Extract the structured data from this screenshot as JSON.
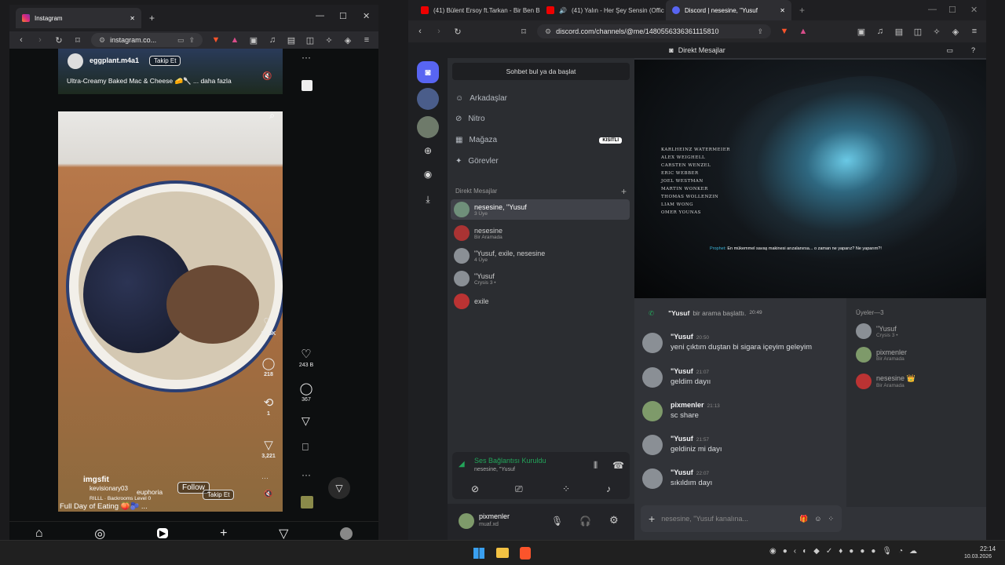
{
  "instagram": {
    "tab_title": "Instagram",
    "url": "instagram.co...",
    "reel_top": {
      "username": "eggplant.m4a1",
      "follow": "Takip Et",
      "caption": "Ultra-Creamy Baked Mac & Cheese 🧀🥄 ... daha fazla"
    },
    "reel_main": {
      "likes": "33.6K",
      "comments": "218",
      "reposts": "1",
      "shares": "3,221",
      "user": "imgsfit",
      "follow": "Follow",
      "music_user": "kevisionary03",
      "music_a": "euphoria",
      "music": "RILLL · Backrooms Level 0",
      "follow2": "Takip Et",
      "caption": "Full Day of Eating 🍑🫐 ..."
    },
    "outer_side": {
      "likes": "243 B",
      "comments": "367"
    },
    "nav_icons": [
      "home-icon",
      "explore-icon",
      "reels-icon",
      "create-icon",
      "messages-icon",
      "profile-icon"
    ]
  },
  "discord": {
    "tabs": [
      "(41) Bülent Ersoy ft.Tarkan - Bir Ben B",
      "(41) Yalın - Her Şey Sensin (Offic",
      "Discord | nesesine, \"Yusuf"
    ],
    "url": "discord.com/channels/@me/1480556336361115810",
    "header": "Direkt Mesajlar",
    "search": "Sohbet bul ya da başlat",
    "nav": [
      {
        "label": "Arkadaşlar",
        "icon": "friends-icon"
      },
      {
        "label": "Nitro",
        "icon": "nitro-icon"
      },
      {
        "label": "Mağaza",
        "icon": "shop-icon",
        "badge": "KISITLI"
      },
      {
        "label": "Görevler",
        "icon": "quests-icon"
      }
    ],
    "dm_header": "Direkt Mesajlar",
    "dms": [
      {
        "name": "nesesine, \"Yusuf",
        "sub": "3 Üye"
      },
      {
        "name": "nesesine",
        "sub": "Bir Aramada"
      },
      {
        "name": "\"Yusuf, exile, nesesine",
        "sub": "4 Üye"
      },
      {
        "name": "\"Yusuf",
        "sub": "Crysis 3 •"
      },
      {
        "name": "exile",
        "sub": ""
      }
    ],
    "voice": {
      "status": "Ses Bağlantısı Kuruldu",
      "channel": "nesesine, \"Yusuf"
    },
    "user": {
      "name": "pixmenler",
      "tag": "muaf.xd"
    },
    "video_credits": [
      "KARLHEINZ WATERMEIER",
      "ALEX WEIGHELL",
      "CARSTEN WENZEL",
      "ERIC WEBBER",
      "JOEL WESTMAN",
      "MARTIN WONKER",
      "THOMAS WOLLENZIN",
      "LIAM WONG",
      "OMER YOUNAS"
    ],
    "video_subtitle_speaker": "Prophet:",
    "video_subtitle": "En mükemmel savaş makinesi arızalanırsa... o zaman ne yaparız? Ne yaparım?!",
    "call_line": {
      "user": "\"Yusuf",
      "text": "bir arama başlattı.",
      "time": "20:49"
    },
    "messages": [
      {
        "user": "\"Yusuf",
        "time": "20:50",
        "text": "yeni çıktım duştan bi sigara içeyim geleyim"
      },
      {
        "user": "\"Yusuf",
        "time": "21:07",
        "text": "geldim dayıı"
      },
      {
        "user": "pixmenler",
        "time": "21:13",
        "text": "sc share"
      },
      {
        "user": "\"Yusuf",
        "time": "21:57",
        "text": "geldiniz mi dayı"
      },
      {
        "user": "\"Yusuf",
        "time": "22:07",
        "text": "sıkıldım dayı"
      }
    ],
    "members_header": "Üyeler—3",
    "members": [
      {
        "name": "\"Yusuf",
        "sub": "Crysis 3 •"
      },
      {
        "name": "pixmenler",
        "sub": "Bir Aramada"
      },
      {
        "name": "nesesine 👑",
        "sub": "Bir Aramada"
      }
    ],
    "input_placeholder": "nesesine, \"Yusuf kanalına..."
  },
  "taskbar": {
    "time": "22:14",
    "date": "10.03.2026"
  }
}
